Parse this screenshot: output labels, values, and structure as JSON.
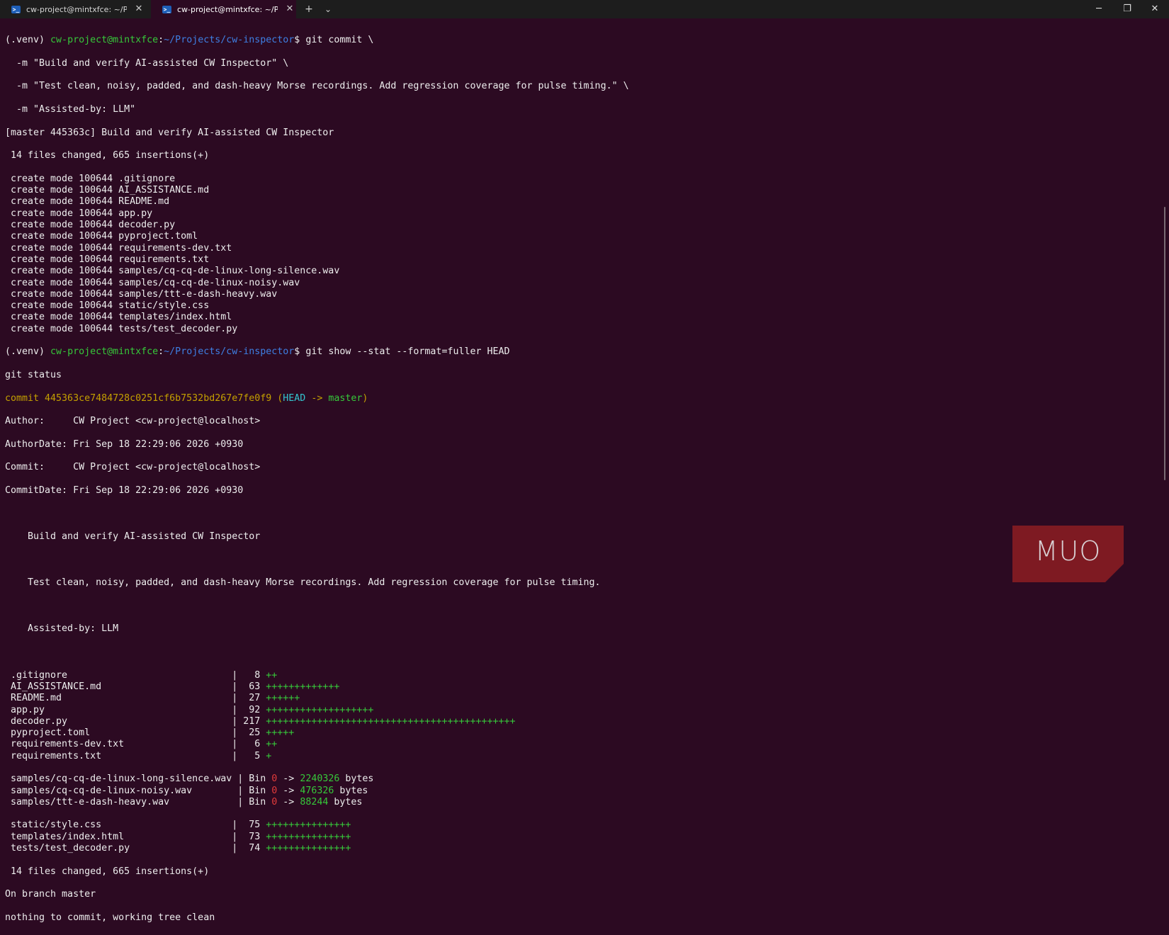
{
  "tabs": [
    {
      "title": "cw-project@mintxfce: ~/Proje",
      "icon": "powershell-icon"
    },
    {
      "title": "cw-project@mintxfce: ~/Proj",
      "icon": "powershell-icon"
    }
  ],
  "titlebar": {
    "new_tab": "+",
    "dropdown": "⌄",
    "minimize": "─",
    "maximize": "❐",
    "close": "✕"
  },
  "colors": {
    "background": "#2c0a22",
    "prompt_user": "#36c83a",
    "prompt_path": "#3e7fe3",
    "commit_hash": "#c4a000",
    "head_ref": "#34c4cf",
    "branch_ref": "#36c83a",
    "diff_plus": "#36c83a",
    "bin_old": "#e33b3b"
  },
  "prompt": {
    "venv": "(.venv) ",
    "user_host": "cw-project@mintxfce",
    "colon": ":",
    "path": "~/Projects/cw-inspector",
    "symbol": "$ "
  },
  "commit_cmd": {
    "line1": "git commit \\",
    "line2": "  -m \"Build and verify AI-assisted CW Inspector\" \\",
    "line3": "  -m \"Test clean, noisy, padded, and dash-heavy Morse recordings. Add regression coverage for pulse timing.\" \\",
    "line4": "  -m \"Assisted-by: LLM\""
  },
  "commit_result": {
    "header": "[master 445363c] Build and verify AI-assisted CW Inspector",
    "summary": " 14 files changed, 665 insertions(+)",
    "create_prefix": " create mode 100644 ",
    "files": [
      ".gitignore",
      "AI_ASSISTANCE.md",
      "README.md",
      "app.py",
      "decoder.py",
      "pyproject.toml",
      "requirements-dev.txt",
      "requirements.txt",
      "samples/cq-cq-de-linux-long-silence.wav",
      "samples/cq-cq-de-linux-noisy.wav",
      "samples/ttt-e-dash-heavy.wav",
      "static/style.css",
      "templates/index.html",
      "tests/test_decoder.py"
    ]
  },
  "show_cmd": {
    "command": "git show --stat --format=fuller HEAD",
    "typed_next": "git status"
  },
  "show": {
    "commit_label": "commit 445363ce7484728c0251cf6b7532bd267e7fe0f9",
    "ref_open": " (",
    "head": "HEAD",
    "arrow": " -> ",
    "branch": "master",
    "ref_close": ")",
    "author": "Author:     CW Project <cw-project@localhost>",
    "author_date": "AuthorDate: Fri Sep 18 22:29:06 2026 +0930",
    "committer": "Commit:     CW Project <cw-project@localhost>",
    "commit_date": "CommitDate: Fri Sep 18 22:29:06 2026 +0930",
    "msg1": "    Build and verify AI-assisted CW Inspector",
    "msg2": "    Test clean, noisy, padded, and dash-heavy Morse recordings. Add regression coverage for pulse timing.",
    "msg3": "    Assisted-by: LLM"
  },
  "stat": {
    "rows": [
      {
        "name": " .gitignore                             ",
        "sep": "| ",
        "count": "  8",
        "bar": "++"
      },
      {
        "name": " AI_ASSISTANCE.md                       ",
        "sep": "| ",
        "count": " 63",
        "bar": "+++++++++++++"
      },
      {
        "name": " README.md                              ",
        "sep": "| ",
        "count": " 27",
        "bar": "++++++"
      },
      {
        "name": " app.py                                 ",
        "sep": "| ",
        "count": " 92",
        "bar": "+++++++++++++++++++"
      },
      {
        "name": " decoder.py                             ",
        "sep": "| ",
        "count": "217",
        "bar": "++++++++++++++++++++++++++++++++++++++++++++"
      },
      {
        "name": " pyproject.toml                         ",
        "sep": "| ",
        "count": " 25",
        "bar": "+++++"
      },
      {
        "name": " requirements-dev.txt                   ",
        "sep": "| ",
        "count": "  6",
        "bar": "++"
      },
      {
        "name": " requirements.txt                       ",
        "sep": "| ",
        "count": "  5",
        "bar": "+"
      }
    ],
    "bin_rows": [
      {
        "name": " samples/cq-cq-de-linux-long-silence.wav ",
        "sep": "| Bin ",
        "old": "0",
        "arrow": " -> ",
        "new": "2240326",
        "unit": " bytes"
      },
      {
        "name": " samples/cq-cq-de-linux-noisy.wav        ",
        "sep": "| Bin ",
        "old": "0",
        "arrow": " -> ",
        "new": "476326",
        "unit": " bytes"
      },
      {
        "name": " samples/ttt-e-dash-heavy.wav            ",
        "sep": "| Bin ",
        "old": "0",
        "arrow": " -> ",
        "new": "88244",
        "unit": " bytes"
      }
    ],
    "rows2": [
      {
        "name": " static/style.css                       ",
        "sep": "| ",
        "count": " 75",
        "bar": "+++++++++++++++"
      },
      {
        "name": " templates/index.html                   ",
        "sep": "| ",
        "count": " 73",
        "bar": "+++++++++++++++"
      },
      {
        "name": " tests/test_decoder.py                  ",
        "sep": "| ",
        "count": " 74",
        "bar": "+++++++++++++++"
      }
    ],
    "summary": " 14 files changed, 665 insertions(+)"
  },
  "status": {
    "branch_line": "On branch master",
    "clean_line": "nothing to commit, working tree clean"
  },
  "watermark": {
    "text": "MUO"
  }
}
